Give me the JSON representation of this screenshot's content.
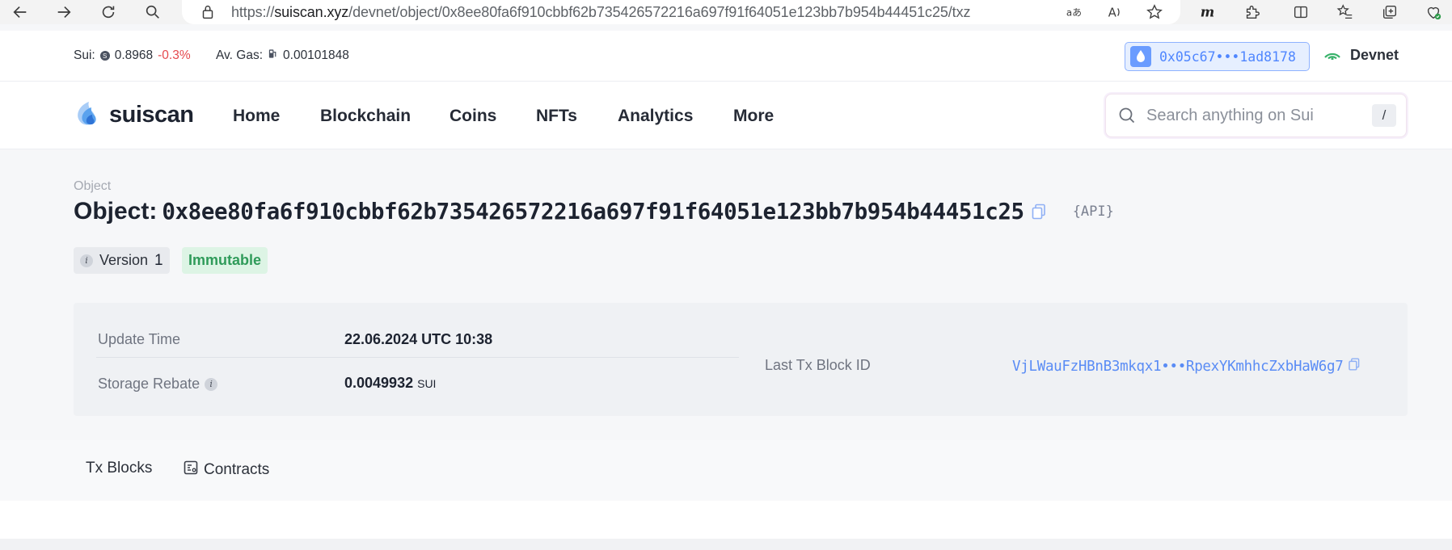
{
  "browser": {
    "url_prefix": "https://",
    "url_host": "suiscan.xyz",
    "url_path": "/devnet/object/0x8ee80fa6f910cbbf62b735426572216a697f91f64051e123bb7b954b44451c25/txz",
    "icons": [
      "back-icon",
      "forward-icon",
      "reload-icon",
      "search-icon",
      "lock-icon",
      "translate-icon",
      "read-aloud-icon",
      "favorite-star-icon",
      "m-extension-icon",
      "extensions-puzzle-icon",
      "split-screen-icon",
      "favorites-list-icon",
      "collections-icon",
      "browser-essentials-icon"
    ]
  },
  "stats": {
    "sui_label": "Sui:",
    "sui_price": "0.8968",
    "sui_change": "-0.3%",
    "gas_label": "Av. Gas:",
    "gas_value": "0.00101848",
    "negative_color": "#e5484d"
  },
  "wallet": {
    "address": "0x05c67•••1ad8178",
    "accent": "#4f86ff"
  },
  "network": {
    "label": "Devnet",
    "color": "#38b26a"
  },
  "nav": {
    "logo_text": "suiscan",
    "items": [
      "Home",
      "Blockchain",
      "Coins",
      "NFTs",
      "Analytics",
      "More"
    ],
    "search_placeholder": "Search anything on Sui",
    "search_shortcut": "/"
  },
  "page": {
    "breadcrumb": "Object",
    "title_label": "Object:",
    "object_id": "0x8ee80fa6f910cbbf62b735426572216a697f91f64051e123bb7b954b44451c25",
    "api_label": "{API}",
    "version_label": "Version",
    "version_value": "1",
    "status_badge": "Immutable"
  },
  "details": {
    "update_time_label": "Update Time",
    "update_time_value": "22.06.2024 UTC 10:38",
    "storage_rebate_label": "Storage Rebate",
    "storage_rebate_value": "0.0049932",
    "storage_rebate_unit": "SUI",
    "last_tx_label": "Last Tx Block ID",
    "last_tx_value": "VjLWauFzHBnB3mkqx1•••RpexYKmhhcZxbHaW6g7"
  },
  "tabs": {
    "items": [
      "Tx Blocks",
      "Contracts"
    ]
  }
}
